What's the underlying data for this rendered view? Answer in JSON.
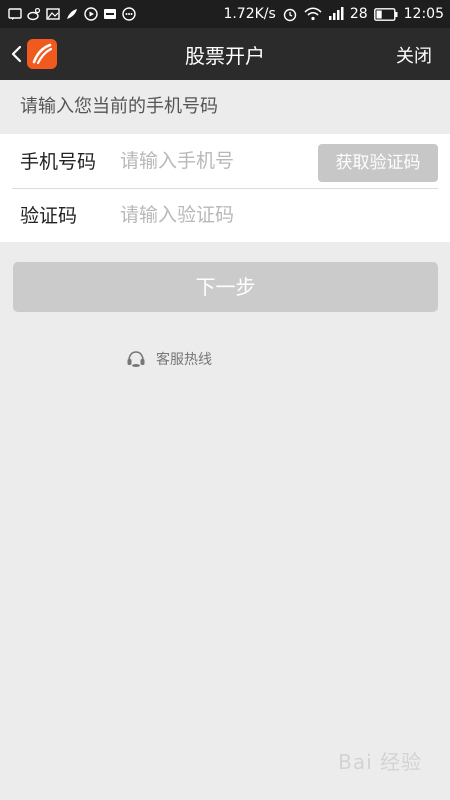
{
  "status_bar": {
    "network_speed": "1.72K/s",
    "battery_level": "28",
    "time": "12:05"
  },
  "header": {
    "title": "股票开户",
    "close_label": "关闭"
  },
  "form": {
    "hint": "请输入您当前的手机号码",
    "phone_label": "手机号码",
    "phone_placeholder": "请输入手机号",
    "get_code_label": "获取验证码",
    "code_label": "验证码",
    "code_placeholder": "请输入验证码"
  },
  "next_label": "下一步",
  "hotline_label": "客服热线",
  "watermark_text": "Bai 经验",
  "colors": {
    "status_bar_bg": "#1e1e1e",
    "title_bar_bg": "#2b2b2b",
    "logo_orange": "#f05a1e",
    "page_bg": "#ececec",
    "disabled_button": "#c7c7c7"
  }
}
